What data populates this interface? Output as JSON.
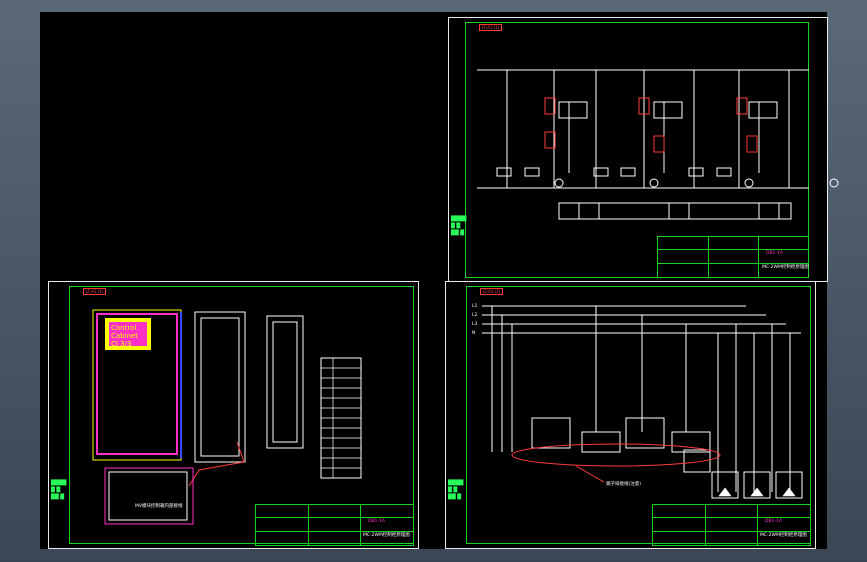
{
  "sheet_tr": {
    "tab": "LT-A1 (1)",
    "titleblock_code": "DB1-1A",
    "titleblock_title": "MC-2WM控制柜原理图",
    "circuit_labels": [
      "1M1",
      "2M1",
      "3M1",
      "4M1"
    ]
  },
  "sheet_bl": {
    "tab": "LT-A1 (1)",
    "panel_text": [
      "Control",
      "Cabinet",
      "CJ 3/3"
    ],
    "callout": "MV模块控制箱内部接线",
    "titleblock_code": "DB1-1A",
    "titleblock_title": "MC-2WM控制柜原理图",
    "bom_rows": [
      "1",
      "2",
      "3",
      "4",
      "5",
      "6",
      "7",
      "8",
      "9",
      "10",
      "11",
      "12",
      "13",
      "14",
      "15",
      "16",
      "17"
    ]
  },
  "sheet_br": {
    "tab": "LT-A1 (1)",
    "bus_labels": [
      "L1",
      "L2",
      "L3",
      "N"
    ],
    "terminal_note": "端子排接线(注意)",
    "titleblock_code": "DB1-1A",
    "titleblock_title": "MC-2WM控制柜原理图"
  },
  "colors": {
    "background": "#000000",
    "border": "#e9e9e9",
    "frame_green": "#18d418",
    "wire_white": "#ffffff",
    "highlight_red": "#ff3b3b",
    "panel_magenta": "#ff2fc8",
    "panel_yellow": "#ffff00",
    "panel_blue": "#3b4bff"
  }
}
